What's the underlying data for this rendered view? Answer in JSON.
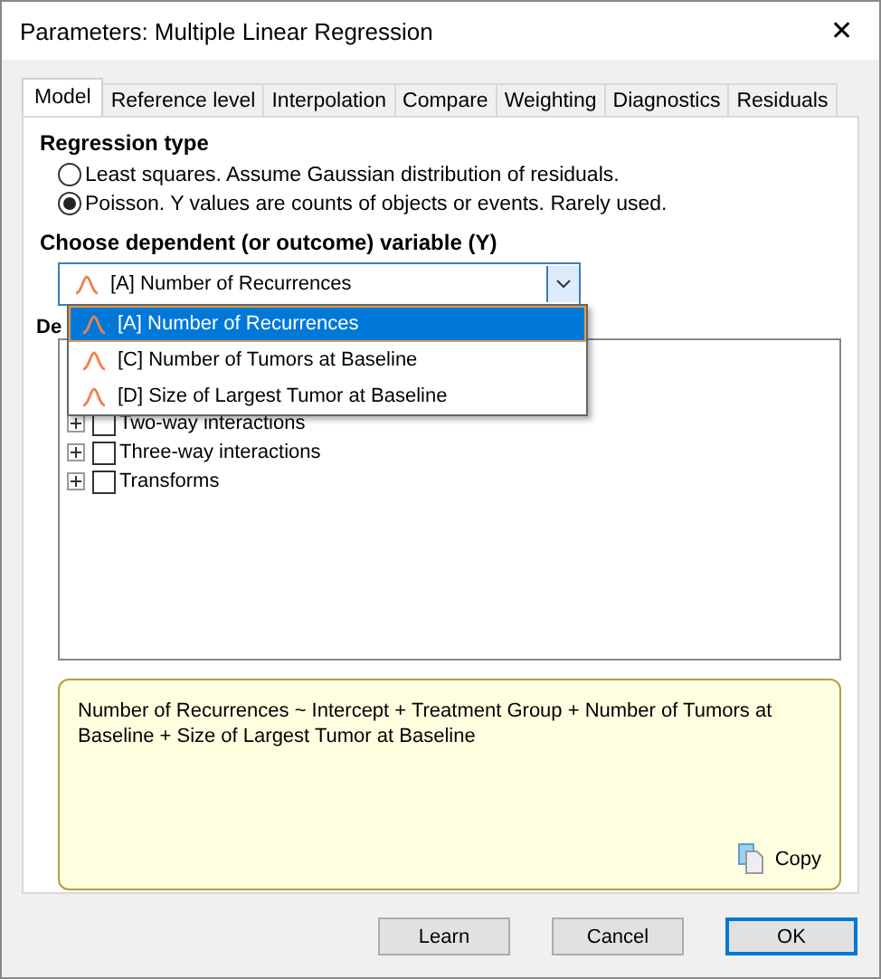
{
  "window": {
    "title": "Parameters: Multiple Linear Regression",
    "close": "✕"
  },
  "tabs": [
    {
      "label": "Model",
      "selected": true
    },
    {
      "label": "Reference level",
      "selected": false
    },
    {
      "label": "Interpolation",
      "selected": false
    },
    {
      "label": "Compare",
      "selected": false
    },
    {
      "label": "Weighting",
      "selected": false
    },
    {
      "label": "Diagnostics",
      "selected": false
    },
    {
      "label": "Residuals",
      "selected": false
    }
  ],
  "regression_type": {
    "heading": "Regression type",
    "options": [
      {
        "label": "Least squares. Assume Gaussian distribution of residuals.",
        "selected": false
      },
      {
        "label": "Poisson. Y values are counts of objects or events. Rarely used.",
        "selected": true
      }
    ]
  },
  "dependent_variable": {
    "heading": "Choose dependent (or outcome) variable (Y)",
    "value": "[A] Number of Recurrences",
    "expanded": true,
    "options": [
      {
        "label": "[A] Number of Recurrences",
        "selected": true
      },
      {
        "label": "[C] Number of Tumors at Baseline",
        "selected": false
      },
      {
        "label": "[D] Size of Largest Tumor at Baseline",
        "selected": false
      }
    ]
  },
  "effects": {
    "heading": "De",
    "items": [
      {
        "label": "Two-way interactions",
        "checked": false
      },
      {
        "label": "Three-way interactions",
        "checked": false
      },
      {
        "label": "Transforms",
        "checked": false
      }
    ]
  },
  "equation": {
    "text": "Number of Recurrences ~ Intercept + Treatment Group + Number of Tumors at Baseline + Size of Largest Tumor at Baseline",
    "copy": "Copy"
  },
  "buttons": [
    {
      "label": "Learn",
      "default": false
    },
    {
      "label": "Cancel",
      "default": false
    },
    {
      "label": "OK",
      "default": true
    }
  ]
}
